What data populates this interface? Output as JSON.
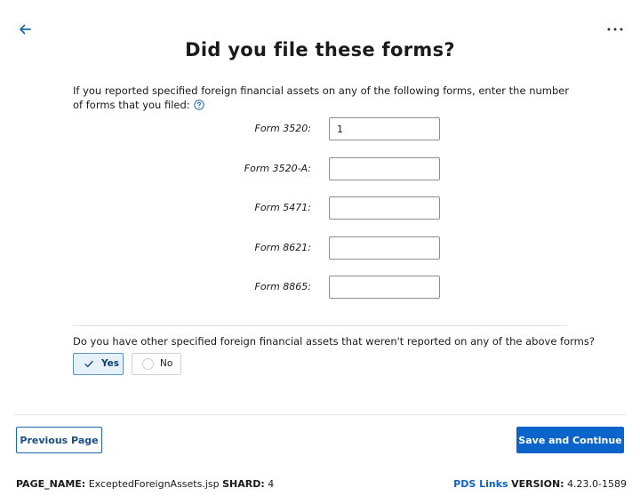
{
  "header": {
    "back_icon": "arrow-left-icon",
    "more_icon": "ellipsis-horizontal-icon",
    "title": "Did you file these forms?"
  },
  "intro": {
    "text": "If you reported specified foreign financial assets on any of the following forms, enter the number of forms that you filed:",
    "help_icon": "question-circle-icon"
  },
  "forms": [
    {
      "label": "Form 3520:",
      "value": "1"
    },
    {
      "label": "Form 3520-A:",
      "value": ""
    },
    {
      "label": "Form 5471:",
      "value": ""
    },
    {
      "label": "Form 8621:",
      "value": ""
    },
    {
      "label": "Form 8865:",
      "value": ""
    }
  ],
  "question": {
    "text": "Do you have other specified foreign financial assets that weren't reported on any of the above forms?",
    "options": [
      {
        "label": "Yes",
        "selected": true
      },
      {
        "label": "No",
        "selected": false
      }
    ]
  },
  "footer": {
    "previous_label": "Previous Page",
    "save_label": "Save and Continue"
  },
  "meta": {
    "page_name_label": "PAGE_NAME:",
    "page_name_value": "ExceptedForeignAssets.jsp",
    "shard_label": "SHARD:",
    "shard_value": "4",
    "pds_links": "PDS Links",
    "version_label": "VERSION:",
    "version_value": "4.23.0-1589"
  },
  "colors": {
    "accent": "#0b64c9",
    "selected_bg": "#e6f1fa",
    "selected_border": "#5b93c8"
  }
}
